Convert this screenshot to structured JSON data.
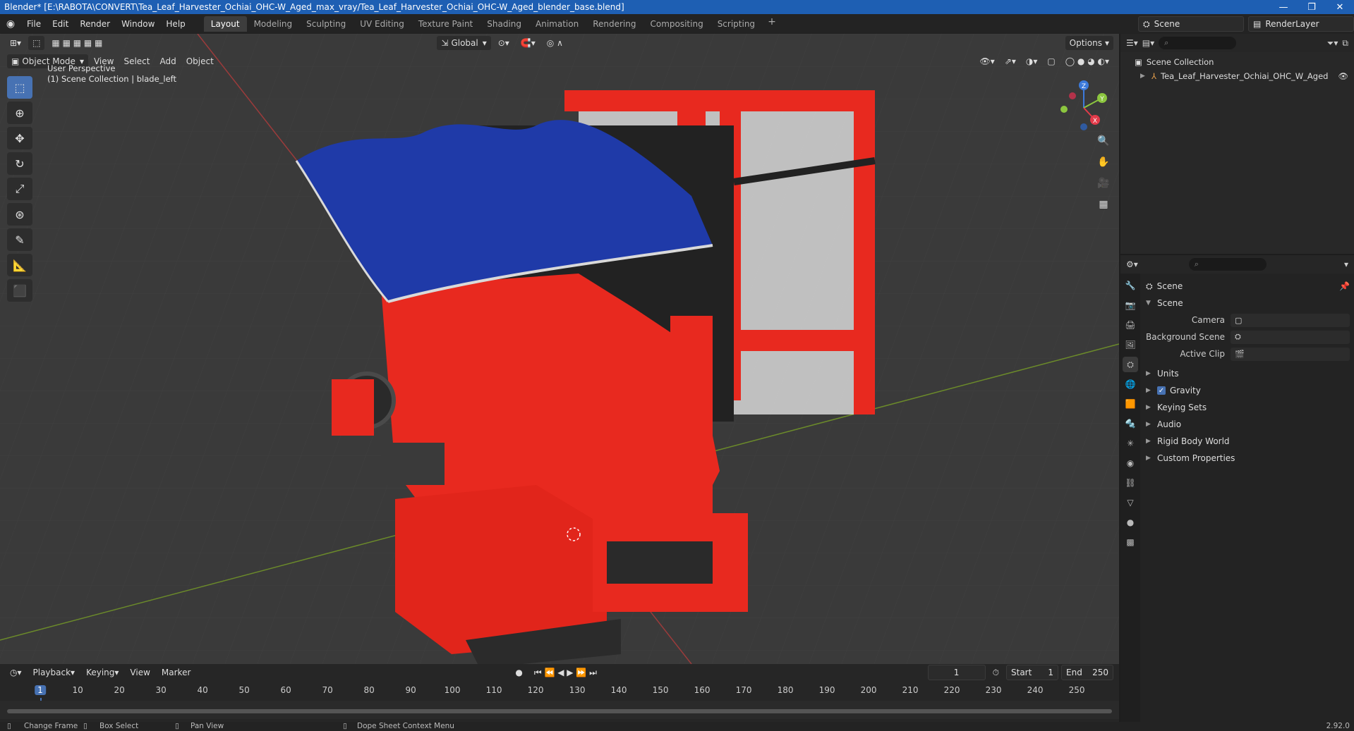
{
  "window": {
    "title": "Blender* [E:\\RABOTA\\CONVERT\\Tea_Leaf_Harvester_Ochiai_OHC-W_Aged_max_vray/Tea_Leaf_Harvester_Ochiai_OHC-W_Aged_blender_base.blend]",
    "minimize": "—",
    "maximize": "❐",
    "close": "✕"
  },
  "menubar": {
    "logo": "◉",
    "items": [
      "File",
      "Edit",
      "Render",
      "Window",
      "Help"
    ]
  },
  "workspaces": {
    "tabs": [
      "Layout",
      "Modeling",
      "Sculpting",
      "UV Editing",
      "Texture Paint",
      "Shading",
      "Animation",
      "Rendering",
      "Compositing",
      "Scripting"
    ],
    "active": "Layout",
    "add": "+"
  },
  "top_right": {
    "scene_label": "Scene",
    "render_layer_label": "RenderLayer"
  },
  "viewport": {
    "transform_orientation": "Global",
    "options_label": "Options",
    "mode": "Object Mode",
    "menus": [
      "View",
      "Select",
      "Add",
      "Object"
    ],
    "overlay_line1": "User Perspective",
    "overlay_line2": "(1) Scene Collection | blade_left",
    "gizmo_axes": {
      "x": "X",
      "y": "Y",
      "z": "Z"
    },
    "colors": {
      "grid_x": "#9b3b3b",
      "grid_y": "#6b8a2a",
      "body_red": "#e8291f",
      "canopy_blue": "#1f3aa8"
    }
  },
  "timeline": {
    "menus": [
      "Playback",
      "Keying",
      "View",
      "Marker"
    ],
    "current_frame": "1",
    "start_label": "Start",
    "start_value": "1",
    "end_label": "End",
    "end_value": "250",
    "ticks": [
      "1",
      "10",
      "20",
      "30",
      "40",
      "50",
      "60",
      "70",
      "80",
      "90",
      "100",
      "110",
      "120",
      "130",
      "140",
      "150",
      "160",
      "170",
      "180",
      "190",
      "200",
      "210",
      "220",
      "230",
      "240",
      "250"
    ]
  },
  "outliner": {
    "root": "Scene Collection",
    "child": "Tea_Leaf_Harvester_Ochiai_OHC_W_Aged"
  },
  "properties": {
    "context": "Scene",
    "section": "Scene",
    "rows": [
      {
        "label": "Camera",
        "value": ""
      },
      {
        "label": "Background Scene",
        "value": ""
      },
      {
        "label": "Active Clip",
        "value": ""
      }
    ],
    "subpanels": [
      "Units",
      "Gravity",
      "Keying Sets",
      "Audio",
      "Rigid Body World",
      "Custom Properties"
    ],
    "gravity_checked": true
  },
  "statusbar": {
    "change_frame": "Change Frame",
    "box_select": "Box Select",
    "pan_view": "Pan View",
    "context_menu": "Dope Sheet Context Menu",
    "version": "2.92.0"
  }
}
